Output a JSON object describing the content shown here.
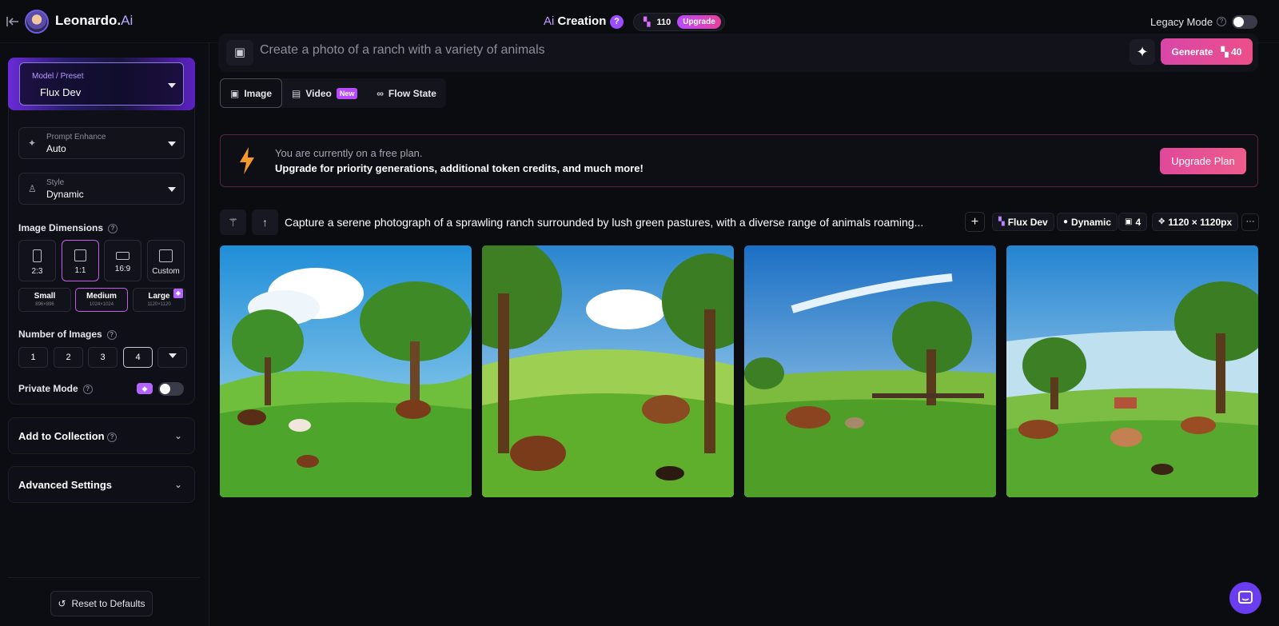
{
  "header": {
    "brand_name": "Leonardo.",
    "brand_suffix": "Ai",
    "ai_prefix": "Ai",
    "creation_label": "Creation",
    "help_badge": "?",
    "token_count": "110",
    "upgrade_label": "Upgrade",
    "legacy_mode_label": "Legacy Mode",
    "legacy_mode_on": false
  },
  "sidebar": {
    "model_label": "Model / Preset",
    "model_value": "Flux Dev",
    "prompt_enhance_label": "Prompt Enhance",
    "prompt_enhance_value": "Auto",
    "style_label": "Style",
    "style_value": "Dynamic",
    "image_dimensions_label": "Image Dimensions",
    "ratios": [
      {
        "label": "2:3",
        "active": false
      },
      {
        "label": "1:1",
        "active": true
      },
      {
        "label": "16:9",
        "active": false
      },
      {
        "label": "Custom",
        "active": false
      }
    ],
    "sizes": [
      {
        "label": "Small",
        "dims": "896×896",
        "active": false
      },
      {
        "label": "Medium",
        "dims": "1024×1024",
        "active": true
      },
      {
        "label": "Large",
        "dims": "1120×1120",
        "active": false
      }
    ],
    "num_images_label": "Number of Images",
    "num_options": [
      "1",
      "2",
      "3",
      "4"
    ],
    "num_selected": "4",
    "private_mode_label": "Private Mode",
    "private_mode_on": false,
    "add_to_collection_label": "Add to Collection",
    "advanced_settings_label": "Advanced Settings",
    "reset_label": "Reset to Defaults"
  },
  "main": {
    "prompt_placeholder": "Create a photo of a ranch with a variety of animals",
    "generate_label": "Generate",
    "generate_cost": "40",
    "tabs": [
      {
        "label": "Image",
        "active": true
      },
      {
        "label": "Video",
        "badge": "New",
        "active": false
      },
      {
        "label": "Flow State",
        "active": false
      }
    ],
    "banner_line1": "You are currently on a free plan.",
    "banner_line2": "Upgrade for priority generations, additional token credits, and much more!",
    "upgrade_plan_label": "Upgrade Plan",
    "generation": {
      "prompt": "Capture a serene photograph of a sprawling ranch surrounded by lush green pastures, with a diverse range of animals roaming...",
      "model": "Flux Dev",
      "style": "Dynamic",
      "count": "4",
      "dimensions": "1120 × 1120px"
    }
  },
  "colors": {
    "accent": "#b84bff",
    "pink": "#e8409a",
    "background": "#0b0c10"
  }
}
